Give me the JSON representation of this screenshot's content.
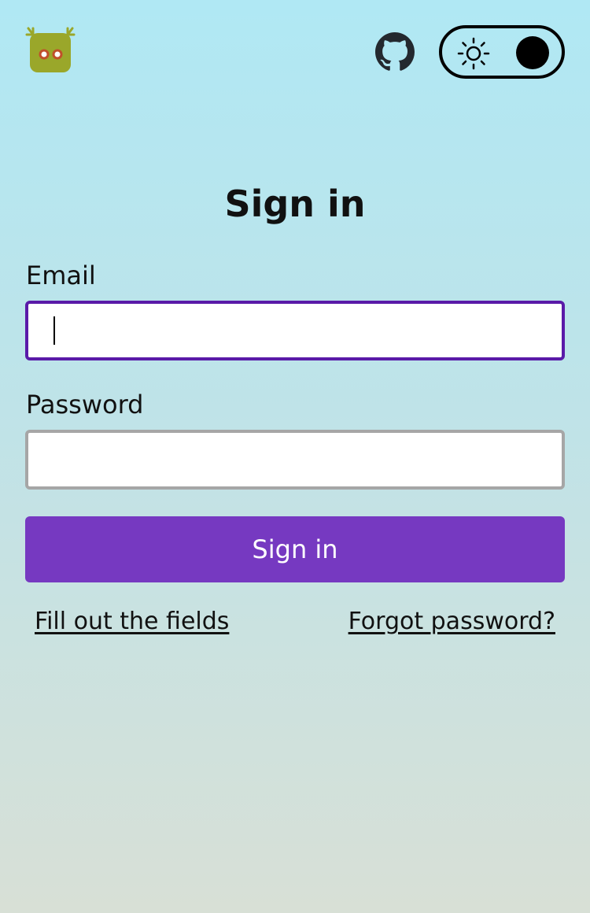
{
  "header": {
    "logo_icon": "robot-logo-icon",
    "github_icon": "github-icon",
    "theme_toggle": {
      "icon": "sun-icon",
      "state": "light"
    }
  },
  "form": {
    "title": "Sign in",
    "email": {
      "label": "Email",
      "value": "",
      "placeholder": ""
    },
    "password": {
      "label": "Password",
      "value": "",
      "placeholder": ""
    },
    "submit_label": "Sign in"
  },
  "links": {
    "fill_fields": "Fill out the fields",
    "forgot_password": "Forgot password?"
  },
  "colors": {
    "accent": "#7639c1",
    "focus_border": "#5a1aa8",
    "logo": "#9aa72a",
    "background_top": "#b0e8f4",
    "background_bottom": "#d8e0d6"
  }
}
